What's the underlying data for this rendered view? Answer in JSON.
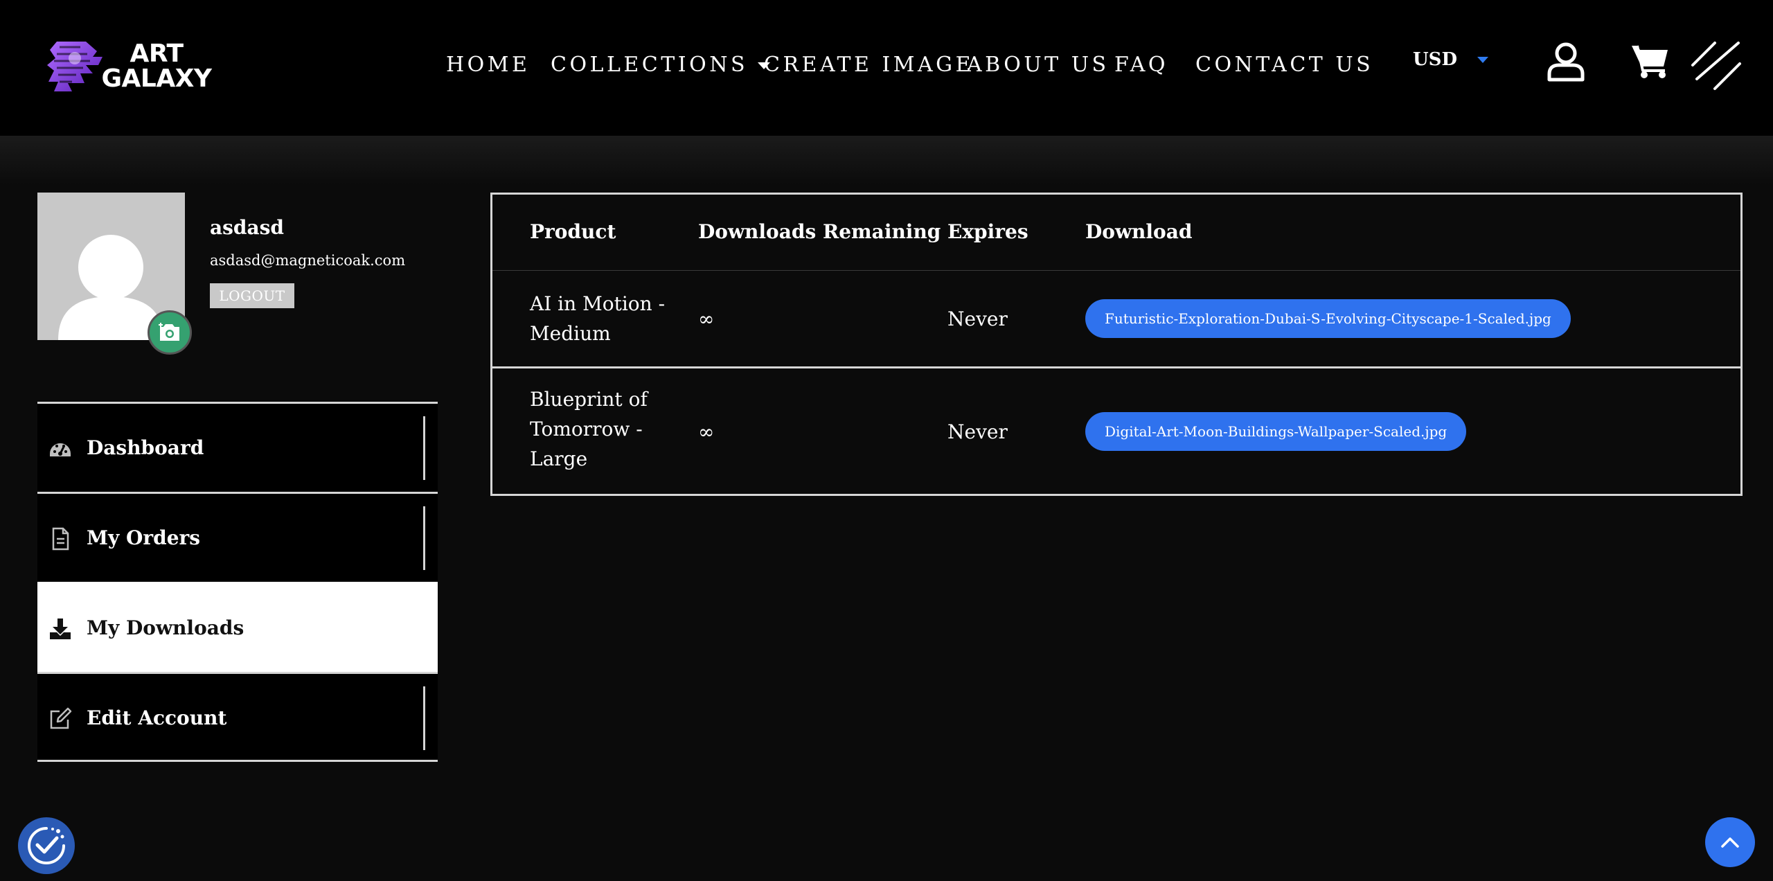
{
  "brand": {
    "line1": "ART",
    "line2": "GALAXY",
    "logo_icon": "art-galaxy-logo"
  },
  "nav": {
    "items": [
      {
        "label": "HOME"
      },
      {
        "label": "COLLECTIONS",
        "has_dropdown": true
      },
      {
        "label": "CREATE IMAGE"
      },
      {
        "label": "ABOUT US"
      },
      {
        "label": "FAQ"
      },
      {
        "label": "CONTACT US"
      }
    ]
  },
  "header": {
    "currency": "USD",
    "icons": [
      "user-icon",
      "cart-icon",
      "menu-toggle-icon"
    ]
  },
  "user": {
    "name": "asdasd",
    "email": "asdasd@magneticoak.com",
    "logout_label": "LOGOUT"
  },
  "sidebar": {
    "items": [
      {
        "label": "Dashboard",
        "icon": "dashboard-icon",
        "active": false
      },
      {
        "label": "My Orders",
        "icon": "document-icon",
        "active": false
      },
      {
        "label": "My Downloads",
        "icon": "download-icon",
        "active": true
      },
      {
        "label": "Edit Account",
        "icon": "edit-icon",
        "active": false
      }
    ]
  },
  "downloads": {
    "headers": [
      "Product",
      "Downloads Remaining",
      "Expires",
      "Download"
    ],
    "rows": [
      {
        "product": "AI in Motion - Medium",
        "remaining": "∞",
        "expires": "Never",
        "file": "Futuristic-Exploration-Dubai-S-Evolving-Cityscape-1-Scaled.jpg"
      },
      {
        "product": "Blueprint of Tomorrow - Large",
        "remaining": "∞",
        "expires": "Never",
        "file": "Digital-Art-Moon-Buildings-Wallpaper-Scaled.jpg"
      }
    ]
  },
  "colors": {
    "accent": "#2f72ee",
    "camera_button": "#35a170",
    "background": "#0b0b0b",
    "header": "#000000"
  }
}
